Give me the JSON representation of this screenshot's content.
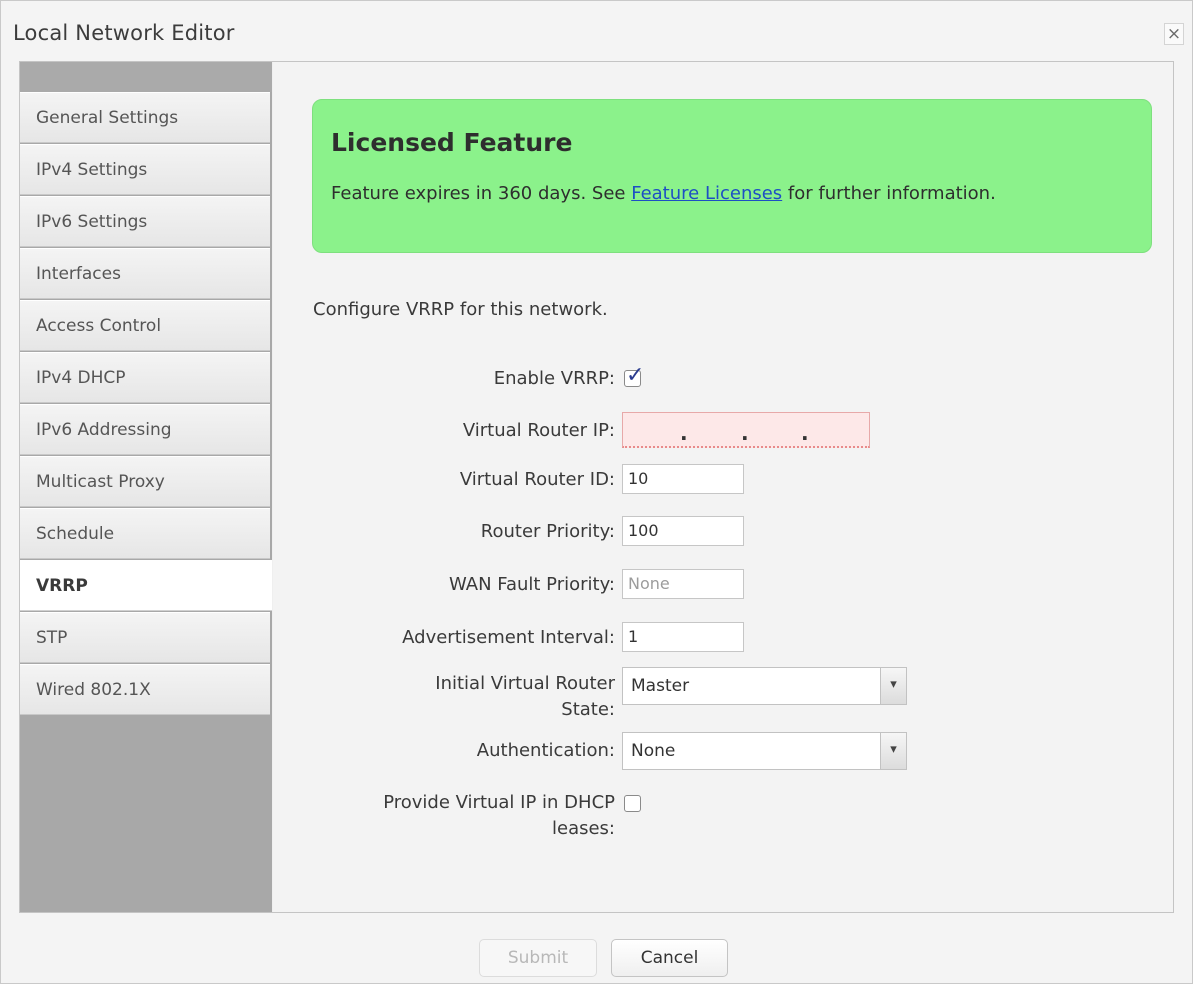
{
  "window": {
    "title": "Local Network Editor",
    "close_label": "×"
  },
  "sidebar": {
    "items": [
      {
        "label": "General Settings"
      },
      {
        "label": "IPv4 Settings"
      },
      {
        "label": "IPv6 Settings"
      },
      {
        "label": "Interfaces"
      },
      {
        "label": "Access Control"
      },
      {
        "label": "IPv4 DHCP"
      },
      {
        "label": "IPv6 Addressing"
      },
      {
        "label": "Multicast Proxy"
      },
      {
        "label": "Schedule"
      },
      {
        "label": "VRRP",
        "active": true
      },
      {
        "label": "STP"
      },
      {
        "label": "Wired 802.1X"
      }
    ]
  },
  "license": {
    "title": "Licensed Feature",
    "text_before": "Feature expires in 360 days. See ",
    "link": "Feature Licenses",
    "text_after": " for further information."
  },
  "intro": "Configure VRRP for this network.",
  "form": {
    "enable_vrrp": {
      "label": "Enable VRRP:",
      "checked": true
    },
    "virtual_router_ip": {
      "label": "Virtual Router IP:",
      "value": ""
    },
    "virtual_router_id": {
      "label": "Virtual Router ID:",
      "value": "10"
    },
    "router_priority": {
      "label": "Router Priority:",
      "value": "100"
    },
    "wan_fault_priority": {
      "label": "WAN Fault Priority:",
      "placeholder": "None"
    },
    "advertisement_interval": {
      "label": "Advertisement Interval:",
      "value": "1"
    },
    "initial_state": {
      "label_line1": "Initial Virtual Router",
      "label_line2": "State:",
      "value": "Master"
    },
    "authentication": {
      "label": "Authentication:",
      "value": "None"
    },
    "provide_virtual_ip": {
      "label_line1": "Provide Virtual IP in DHCP",
      "label_line2": "leases:",
      "checked": false
    }
  },
  "footer": {
    "submit_label": "Submit",
    "cancel_label": "Cancel"
  }
}
